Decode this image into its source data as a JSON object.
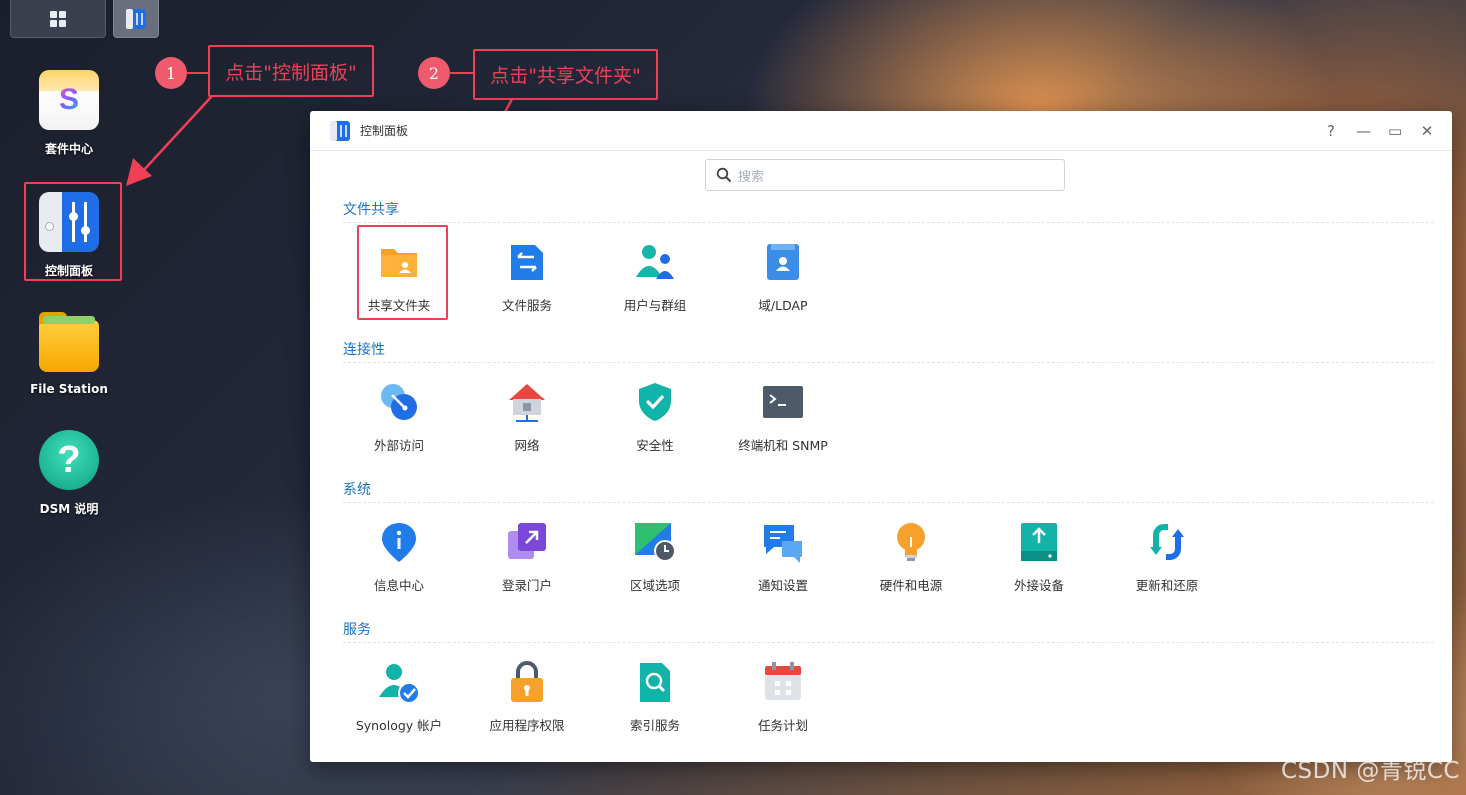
{
  "window": {
    "title": "控制面板",
    "help": "?",
    "minimize": "—",
    "maximize": "▭",
    "close": "✕"
  },
  "search": {
    "placeholder": "搜索"
  },
  "desktop": {
    "items": [
      {
        "label": "套件中心",
        "icon": "package-center-icon"
      },
      {
        "label": "控制面板",
        "icon": "control-panel-icon"
      },
      {
        "label": "File Station",
        "icon": "folder-icon"
      },
      {
        "label": "DSM 说明",
        "icon": "help-icon"
      }
    ]
  },
  "annotations": [
    {
      "number": "1",
      "text": "点击\"控制面板\""
    },
    {
      "number": "2",
      "text": "点击\"共享文件夹\""
    }
  ],
  "sections": [
    {
      "title": "文件共享",
      "items": [
        {
          "label": "共享文件夹",
          "icon": "shared-folder-icon"
        },
        {
          "label": "文件服务",
          "icon": "file-services-icon"
        },
        {
          "label": "用户与群组",
          "icon": "users-groups-icon"
        },
        {
          "label": "域/LDAP",
          "icon": "domain-ldap-icon"
        }
      ]
    },
    {
      "title": "连接性",
      "items": [
        {
          "label": "外部访问",
          "icon": "external-access-icon"
        },
        {
          "label": "网络",
          "icon": "network-icon"
        },
        {
          "label": "安全性",
          "icon": "security-shield-icon"
        },
        {
          "label": "终端机和 SNMP",
          "icon": "terminal-icon"
        }
      ]
    },
    {
      "title": "系统",
      "items": [
        {
          "label": "信息中心",
          "icon": "info-center-icon"
        },
        {
          "label": "登录门户",
          "icon": "login-portal-icon"
        },
        {
          "label": "区域选项",
          "icon": "regional-options-icon"
        },
        {
          "label": "通知设置",
          "icon": "notification-icon"
        },
        {
          "label": "硬件和电源",
          "icon": "hardware-power-icon"
        },
        {
          "label": "外接设备",
          "icon": "external-devices-icon"
        },
        {
          "label": "更新和还原",
          "icon": "update-restore-icon"
        }
      ]
    },
    {
      "title": "服务",
      "items": [
        {
          "label": "Synology 帐户",
          "icon": "synology-account-icon"
        },
        {
          "label": "应用程序权限",
          "icon": "app-privileges-icon"
        },
        {
          "label": "索引服务",
          "icon": "indexing-service-icon"
        },
        {
          "label": "任务计划",
          "icon": "task-scheduler-icon"
        }
      ]
    }
  ],
  "watermark": "CSDN @青锐CC",
  "colors": {
    "accent": "#1a73c9",
    "annotation": "#ef4056"
  }
}
